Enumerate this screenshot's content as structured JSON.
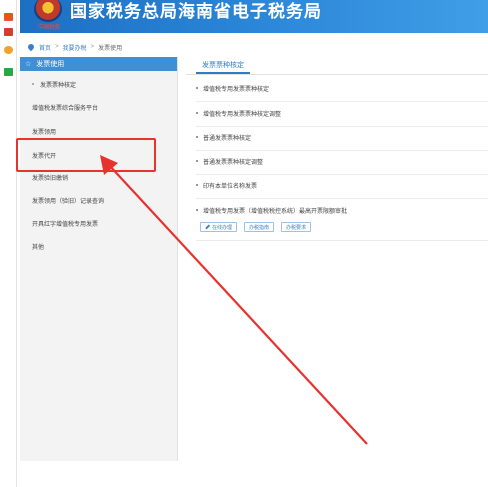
{
  "header": {
    "title": "国家税务总局海南省电子税务局",
    "emblem_text": "中国税务"
  },
  "left_toolbar": {
    "icons": [
      "app-icon",
      "mail-icon",
      "weibo-icon",
      "chat-icon"
    ]
  },
  "breadcrumb": {
    "items": [
      "首页",
      "我要办税",
      "发票使用"
    ],
    "separator": ">"
  },
  "sidebar": {
    "header_label": "发票使用",
    "items": [
      {
        "label": "发票票种核定"
      },
      {
        "label": "增值税发票综合服务平台"
      },
      {
        "label": "发票领用"
      },
      {
        "label": "发票代开"
      },
      {
        "label": "发票验旧缴销"
      },
      {
        "label": "发票领用（验旧）记录查询"
      },
      {
        "label": "开具红字增值税专用发票"
      },
      {
        "label": "其他"
      }
    ]
  },
  "main": {
    "tab_label": "发票票种核定",
    "items": [
      {
        "label": "增值税专用发票票种核定"
      },
      {
        "label": "增值税专用发票票种核定调整"
      },
      {
        "label": "普通发票票种核定"
      },
      {
        "label": "普通发票票种核定调整"
      },
      {
        "label": "印有本单位名称发票"
      },
      {
        "label": "增值税专用发票（增值税税控系统）最高开票限额审批"
      }
    ],
    "actions": [
      {
        "label": "在线办理"
      },
      {
        "label": "办税指南"
      },
      {
        "label": "办税要求"
      }
    ]
  },
  "annotation": {
    "highlight_color": "#e8322d"
  }
}
